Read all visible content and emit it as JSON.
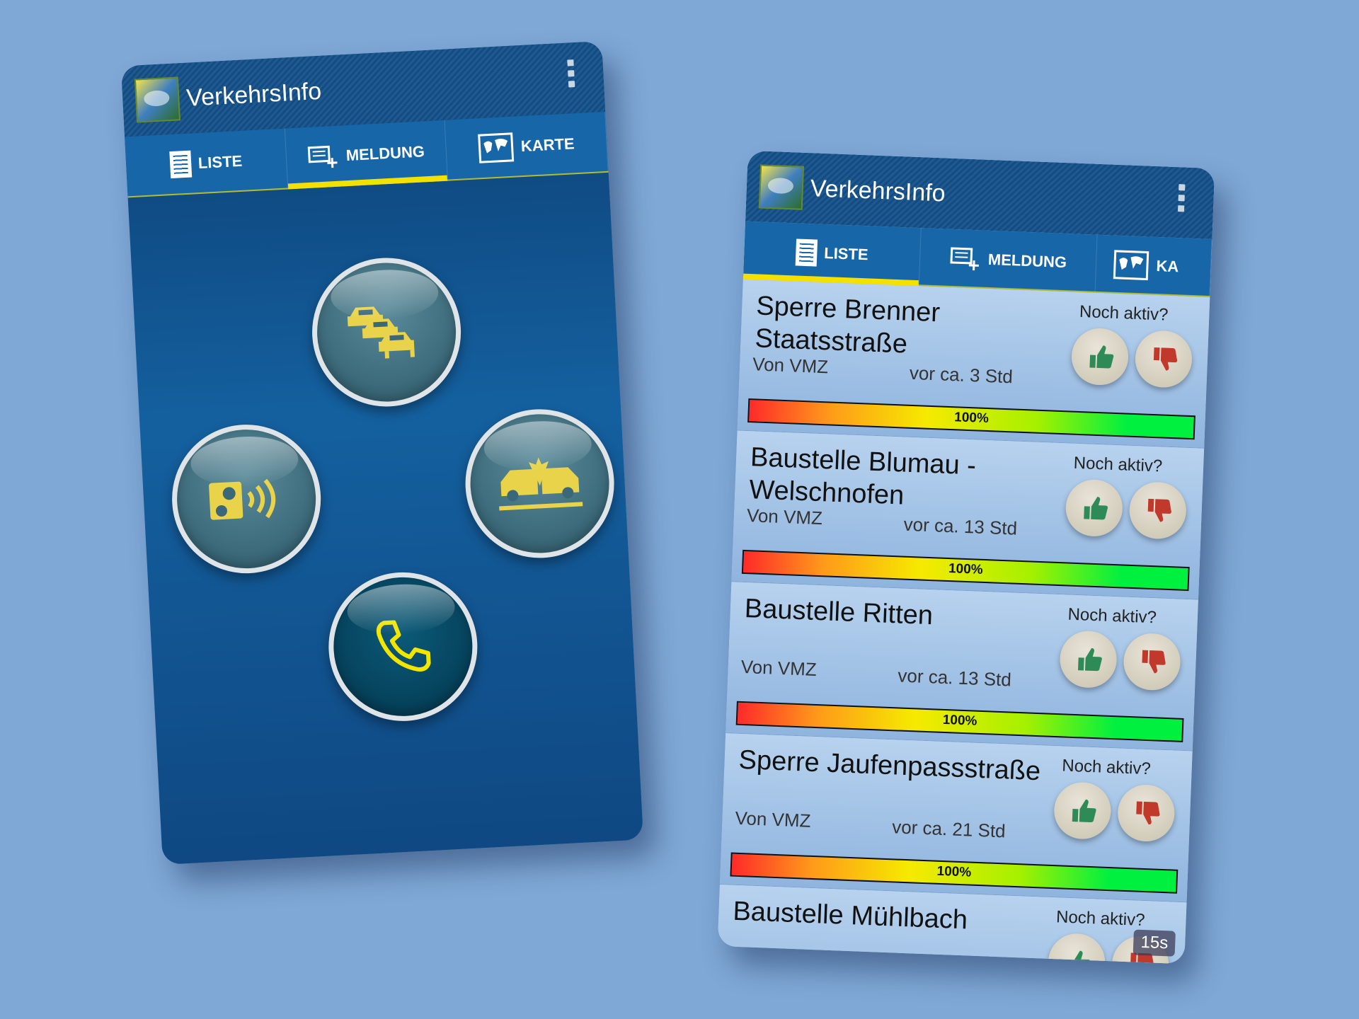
{
  "app": {
    "title": "VerkehrsInfo"
  },
  "tabs": {
    "list": "LISTE",
    "report": "MELDUNG",
    "map": "KARTE",
    "map_cut": "KA"
  },
  "entries": [
    {
      "title": "Sperre Brenner Staatsstraße",
      "source": "Von VMZ",
      "age": "vor ca. 3 Std",
      "question": "Noch aktiv?",
      "progress": "100%"
    },
    {
      "title": "Baustelle Blumau - Welschnofen",
      "source": "Von VMZ",
      "age": "vor ca. 13 Std",
      "question": "Noch aktiv?",
      "progress": "100%"
    },
    {
      "title": "Baustelle Ritten",
      "source": "Von VMZ",
      "age": "vor ca. 13 Std",
      "question": "Noch aktiv?",
      "progress": "100%"
    },
    {
      "title": "Sperre Jaufenpassstraße",
      "source": "Von VMZ",
      "age": "vor ca. 21 Std",
      "question": "Noch aktiv?",
      "progress": "100%"
    },
    {
      "title": "Baustelle Mühlbach",
      "source": "",
      "age": "",
      "question": "Noch aktiv?",
      "progress": ""
    }
  ],
  "timer": "15s",
  "icons": {
    "traffic_jam": "traffic-jam-icon",
    "speed_camera": "speed-camera-icon",
    "accident": "accident-icon",
    "phone": "phone-icon",
    "thumbs_up": "thumbs-up-icon",
    "thumbs_down": "thumbs-down-icon"
  },
  "colors": {
    "background": "#7fa8d6",
    "primary": "#1766a8",
    "accent": "#f3e100",
    "icon_yellow": "#e8d34a",
    "thumb_green": "#2e8b57",
    "thumb_red": "#c0392b"
  }
}
